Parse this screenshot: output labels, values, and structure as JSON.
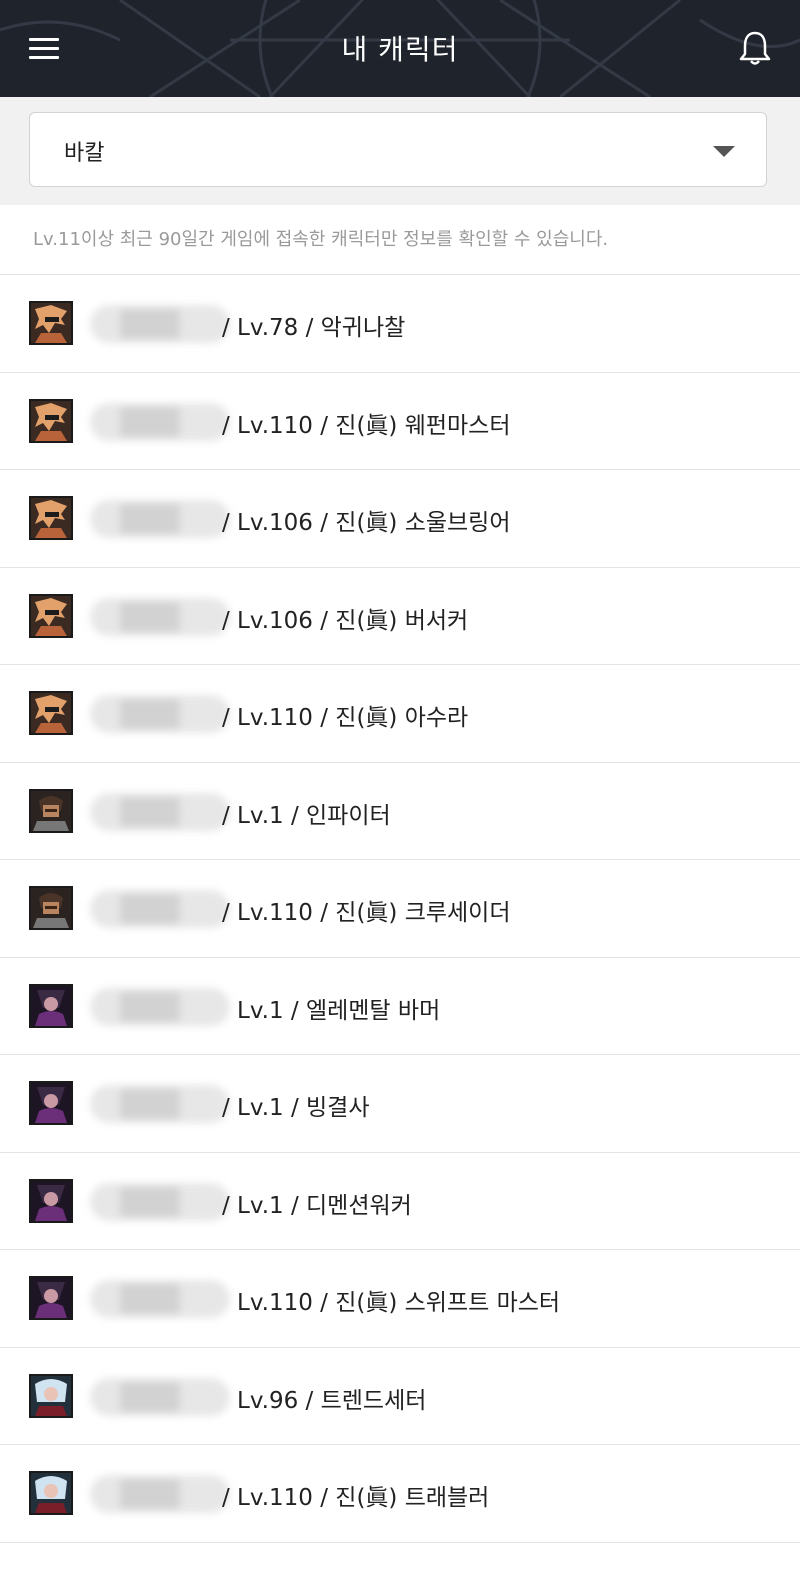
{
  "header": {
    "title": "내 캐릭터",
    "menu_icon": "hamburger-menu-icon",
    "bell_icon": "bell-icon"
  },
  "server_select": {
    "value": "바칼"
  },
  "notice": "Lv.11이상 최근 90일간 게임에 접속한 캐릭터만 정보를 확인할 수 있습니다.",
  "characters": [
    {
      "info": "/ Lv.78 / 악귀나찰",
      "avatar": "slayer-male"
    },
    {
      "info": "/ Lv.110 / 진(眞) 웨펀마스터",
      "avatar": "slayer-male"
    },
    {
      "info": "/ Lv.106 / 진(眞) 소울브링어",
      "avatar": "slayer-male"
    },
    {
      "info": "/ Lv.106 / 진(眞) 버서커",
      "avatar": "slayer-male"
    },
    {
      "info": "/ Lv.110 / 진(眞) 아수라",
      "avatar": "slayer-male"
    },
    {
      "info": "/ Lv.1 / 인파이터",
      "avatar": "priest-male"
    },
    {
      "info": "/ Lv.110 / 진(眞) 크루세이더",
      "avatar": "priest-male"
    },
    {
      "info": "Lv.1 / 엘레멘탈 바머",
      "avatar": "mage-female"
    },
    {
      "info": "/ Lv.1 / 빙결사",
      "avatar": "mage-female"
    },
    {
      "info": "/ Lv.1 / 디멘션워커",
      "avatar": "mage-female"
    },
    {
      "info": "Lv.110 / 진(眞) 스위프트 마스터",
      "avatar": "mage-female"
    },
    {
      "info": "Lv.96 / 트렌드세터",
      "avatar": "gunner-female"
    },
    {
      "info": "/ Lv.110 / 진(眞) 트래블러",
      "avatar": "gunner-female"
    }
  ],
  "colors": {
    "header_bg": "#1f232b",
    "avatar_slayer": "#c9743a",
    "avatar_priest": "#6b4a36",
    "avatar_mage": "#5b2a66",
    "avatar_gunner": "#7fb2d6"
  }
}
